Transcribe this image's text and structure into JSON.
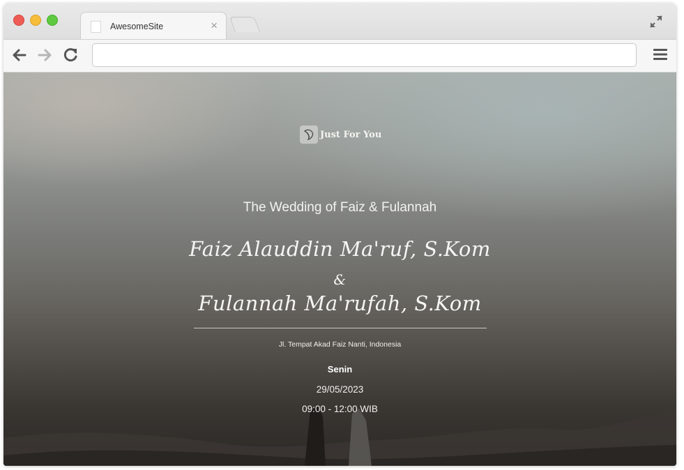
{
  "browser": {
    "tab_title": "AwesomeSite",
    "tab_close_glyph": "×",
    "address_value": "",
    "icons": [
      "back-arrow-icon",
      "forward-arrow-icon",
      "reload-icon",
      "menu-icon",
      "expand-icon",
      "close-icon"
    ]
  },
  "site": {
    "logo_text": "Just For You",
    "heading": "The Wedding of Faiz & Fulannah",
    "groom_name": "Faiz Alauddin Ma'ruf, S.Kom",
    "ampersand": "&",
    "bride_name": "Fulannah Ma'rufah, S.Kom",
    "address": "Jl. Tempat Akad Faiz Nanti, Indonesia",
    "day": "Senin",
    "date": "29/05/2023",
    "time": "09:00 - 12:00 WIB"
  },
  "colors": {
    "close_light": "#ee5d55",
    "minimize_light": "#f6bd3b",
    "maximize_light": "#5fc941",
    "overlay_text": "#f5f5f3"
  }
}
